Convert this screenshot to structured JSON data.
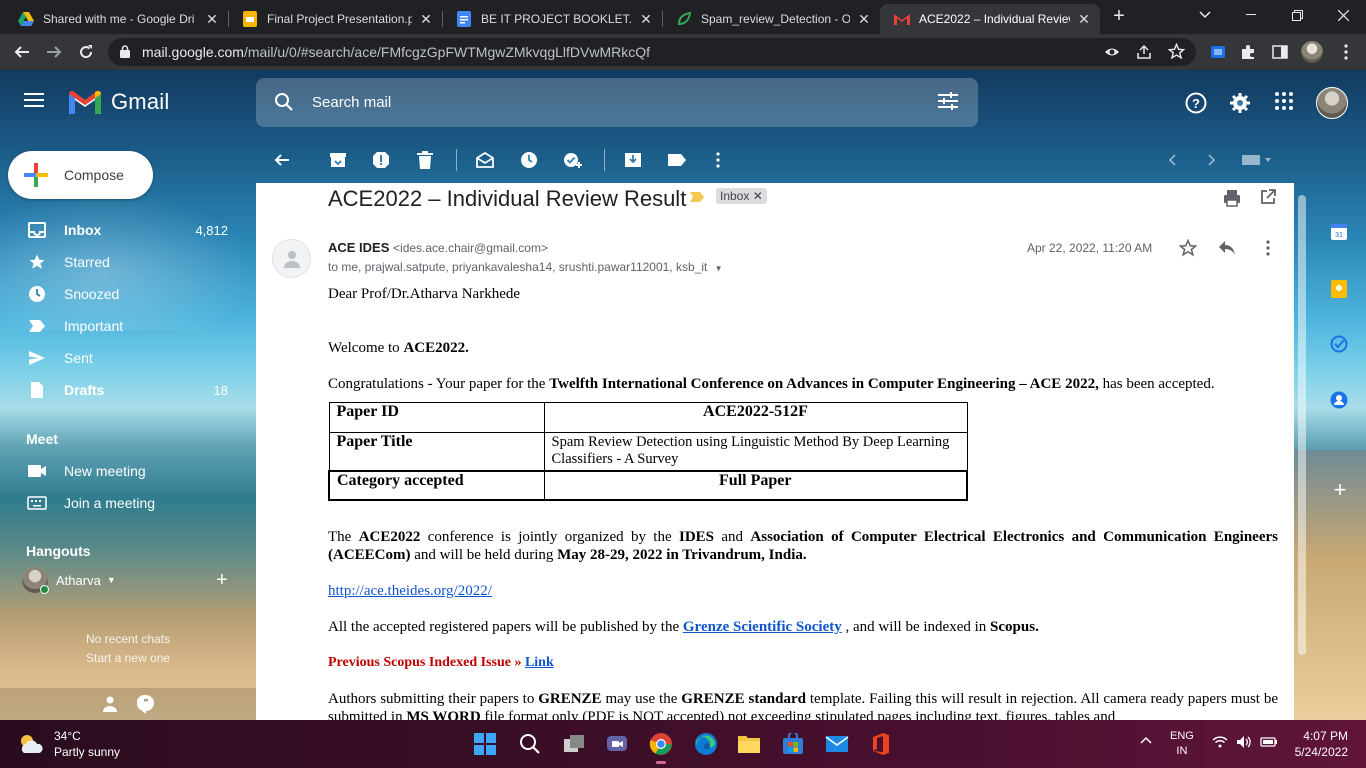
{
  "tabs": [
    {
      "title": "Shared with me - Google Dri",
      "icon": "google-drive-icon"
    },
    {
      "title": "Final Project Presentation.ppt",
      "icon": "google-slides-icon"
    },
    {
      "title": "BE IT PROJECT BOOKLET.docx",
      "icon": "google-docs-icon"
    },
    {
      "title": "Spam_review_Detection - On",
      "icon": "leaf-icon"
    },
    {
      "title": "ACE2022 – Individual Review",
      "icon": "gmail-icon"
    }
  ],
  "address": {
    "host": "mail.google.com",
    "path": "/mail/u/0/#search/ace/FMfcgzGpFWTMgwZMkvqgLlfDVwMRkcQf"
  },
  "gmail": {
    "logo_text": "Gmail",
    "search_placeholder": "Search mail",
    "compose_label": "Compose"
  },
  "nav": [
    {
      "label": "Inbox",
      "count": "4,812",
      "icon": "inbox-icon"
    },
    {
      "label": "Starred",
      "count": "",
      "icon": "star-icon"
    },
    {
      "label": "Snoozed",
      "count": "",
      "icon": "clock-icon"
    },
    {
      "label": "Important",
      "count": "",
      "icon": "important-icon"
    },
    {
      "label": "Sent",
      "count": "",
      "icon": "send-icon"
    },
    {
      "label": "Drafts",
      "count": "18",
      "icon": "draft-icon"
    }
  ],
  "meet": {
    "heading": "Meet",
    "new_meeting": "New meeting",
    "join_meeting": "Join a meeting"
  },
  "hangouts": {
    "heading": "Hangouts",
    "user": "Atharva",
    "no_chats": "No recent chats",
    "start_new": "Start a new one"
  },
  "email": {
    "subject": "ACE2022 – Individual Review Result",
    "label_chip": "Inbox",
    "sender_name": "ACE IDES",
    "sender_email": "<ides.ace.chair@gmail.com>",
    "recipients": "to me, prajwal.satpute, priyankavalesha14, srushti.pawar112001, ksb_it",
    "date": "Apr 22, 2022, 11:20 AM",
    "greeting": "Dear Prof/Dr.Atharva Narkhede",
    "welcome_pre": "Welcome to ",
    "welcome_bold": "ACE2022.",
    "congrats_pre": "Congratulations - Your paper for the ",
    "congrats_bold": "Twelfth International Conference on Advances in Computer Engineering – ACE 2022,",
    "congrats_post": " has been accepted.",
    "table": [
      {
        "label": "Paper ID",
        "value": "ACE2022-512F"
      },
      {
        "label": "Paper Title",
        "value": "Spam Review Detection using Linguistic Method By Deep Learning Classifiers - A Survey"
      },
      {
        "label": "Category accepted",
        "value": "Full Paper"
      }
    ],
    "org_1": "The ",
    "org_2": "ACE2022",
    "org_3": " conference is jointly organized by the ",
    "org_4": "IDES",
    "org_5": " and ",
    "org_6": "Association of Computer Electrical Electronics and Communication Engineers (ACEECom)",
    "org_7": " and will be held during ",
    "org_8": "May 28-29, 2022 in Trivandrum, India.",
    "link_url": "http://ace.theides.org/2022/ ",
    "pub_1": "All the accepted registered papers will be published by the ",
    "pub_link": "Grenze Scientific Society",
    "pub_2": " , and will be indexed in ",
    "pub_3": "Scopus.",
    "prev_label": "Previous Scopus Indexed Issue » ",
    "prev_link": "Link",
    "auth_1": "Authors submitting their papers to ",
    "auth_2": "GRENZE",
    "auth_3": " may use the ",
    "auth_4": "GRENZE standard",
    "auth_5": " template. Failing this will result in rejection. All camera ready papers must be submitted in ",
    "auth_6": "MS WORD",
    "auth_7": " file format only (PDF is NOT accepted) not exceeding stipulated pages including text, figures, tables and"
  },
  "taskbar": {
    "temp": "34°C",
    "weather": "Partly sunny",
    "lang_1": "ENG",
    "lang_2": "IN",
    "time": "4:07 PM",
    "date": "5/24/2022"
  },
  "colors": {
    "accent": "#1a73e8",
    "gmail_red": "#ea4335",
    "link": "#1155cc",
    "prev_red": "#c00000"
  }
}
